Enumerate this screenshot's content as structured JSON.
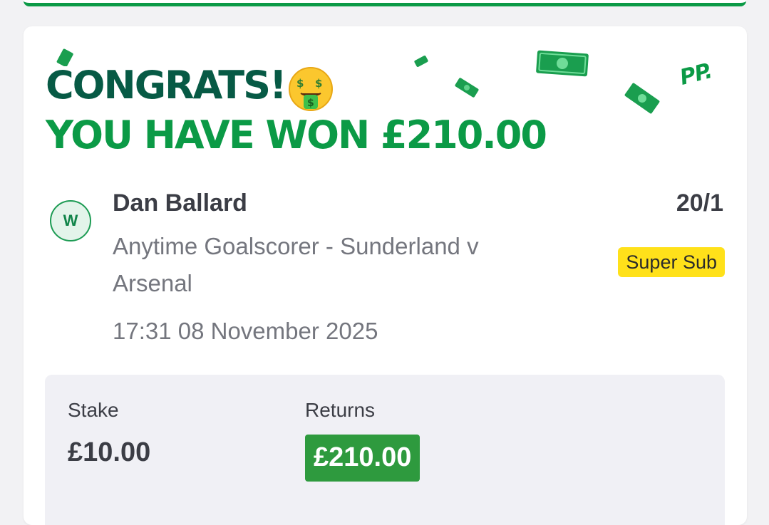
{
  "colors": {
    "brand_dark_green": "#075a45",
    "brand_green": "#0b9a46",
    "returns_green": "#2e9a3e",
    "badge_yellow": "#ffe11a",
    "text_dark": "#3b3d45",
    "text_grey": "#74767e"
  },
  "header": {
    "line1": "CONGRATS!",
    "line2": "YOU HAVE WON £210.00",
    "emoji": "money-mouth-face-icon",
    "logo": "PP."
  },
  "bet": {
    "status": "W",
    "selection": "Dan Ballard",
    "market": "Anytime Goalscorer - Sunderland v Arsenal",
    "datetime": "17:31 08 November 2025",
    "odds": "20/1",
    "badge": "Super Sub"
  },
  "summary": {
    "stake_label": "Stake",
    "stake_value": "£10.00",
    "returns_label": "Returns",
    "returns_value": "£210.00"
  }
}
